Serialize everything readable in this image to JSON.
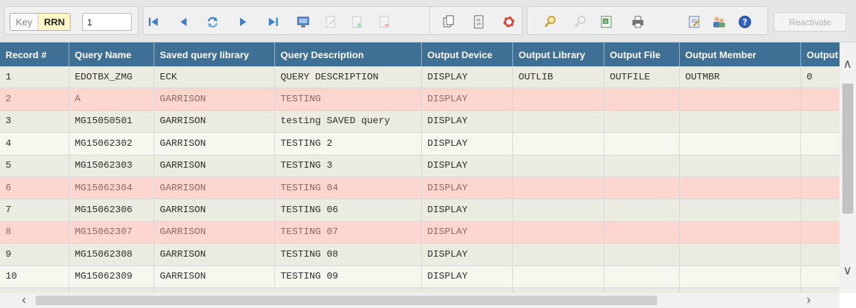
{
  "toolbar": {
    "mode_key_label": "Key",
    "mode_rrn_label": "RRN",
    "rrn_value": "1",
    "reactivate_label": "Reactivate",
    "icons": [
      "first-record-icon",
      "previous-record-icon",
      "refresh-icon",
      "next-record-icon",
      "last-record-icon",
      "display-record-icon",
      "change-record-icon",
      "copy-record-icon",
      "delete-record-icon",
      "copy-icon",
      "field-list-icon",
      "help-ring-icon",
      "find-icon",
      "find-next-icon",
      "export-excel-icon",
      "print-icon",
      "notes-icon",
      "users-icon",
      "help-icon"
    ]
  },
  "columns": [
    "Record #",
    "Query Name",
    "Saved query library",
    "Query Description",
    "Output Device",
    "Output Library",
    "Output File",
    "Output Member",
    "Output O"
  ],
  "rows": [
    {
      "style": "plain",
      "cells": [
        "1",
        "EDOTBX_ZMG",
        "ECK",
        "QUERY DESCRIPTION",
        "DISPLAY",
        "OUTLIB",
        "OUTFILE",
        "OUTMBR",
        "0"
      ]
    },
    {
      "style": "pink",
      "cells": [
        "2",
        "A",
        "GARRISON",
        "TESTING",
        "DISPLAY",
        "",
        "",
        "",
        ""
      ]
    },
    {
      "style": "plain",
      "cells": [
        "3",
        "MG15050501",
        "GARRISON",
        "testing SAVED query",
        "DISPLAY",
        "",
        "",
        "",
        ""
      ]
    },
    {
      "style": "light",
      "cells": [
        "4",
        "MG15062302",
        "GARRISON",
        "TESTING 2",
        "DISPLAY",
        "",
        "",
        "",
        ""
      ]
    },
    {
      "style": "plain",
      "cells": [
        "5",
        "MG15062303",
        "GARRISON",
        "TESTING 3",
        "DISPLAY",
        "",
        "",
        "",
        ""
      ]
    },
    {
      "style": "pink",
      "cells": [
        "6",
        "MG15062304",
        "GARRISON",
        "TESTING 04",
        "DISPLAY",
        "",
        "",
        "",
        ""
      ]
    },
    {
      "style": "plain",
      "cells": [
        "7",
        "MG15062306",
        "GARRISON",
        "TESTING 06",
        "DISPLAY",
        "",
        "",
        "",
        ""
      ]
    },
    {
      "style": "pink",
      "cells": [
        "8",
        "MG15062307",
        "GARRISON",
        "TESTING 07",
        "DISPLAY",
        "",
        "",
        "",
        ""
      ]
    },
    {
      "style": "plain",
      "cells": [
        "9",
        "MG15062308",
        "GARRISON",
        "TESTING 08",
        "DISPLAY",
        "",
        "",
        "",
        ""
      ]
    },
    {
      "style": "light",
      "cells": [
        "10",
        "MG15062309",
        "GARRISON",
        "TESTING 09",
        "DISPLAY",
        "",
        "",
        "",
        ""
      ]
    },
    {
      "style": "plain",
      "cells": [
        "",
        "",
        "",
        "",
        "",
        "",
        "",
        "",
        ""
      ]
    }
  ],
  "colors": {
    "header_bg": "#3e6f95",
    "row_plain": "#ebebe1",
    "row_light": "#f7f7ef",
    "row_pink": "#fdd7cf"
  }
}
